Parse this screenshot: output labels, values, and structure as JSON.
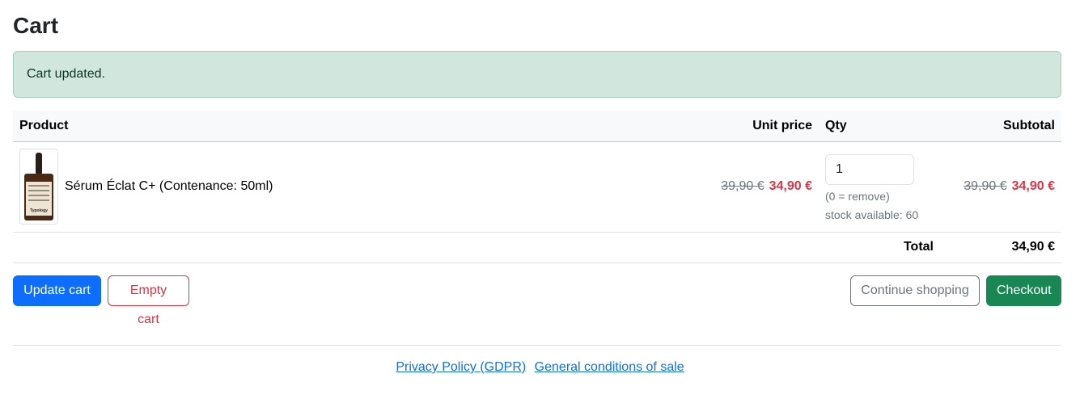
{
  "page": {
    "title": "Cart"
  },
  "alert": {
    "message": "Cart updated."
  },
  "table": {
    "headers": {
      "product": "Product",
      "unit_price": "Unit price",
      "qty": "Qty",
      "subtotal": "Subtotal"
    },
    "items": [
      {
        "name": "Sérum Éclat C+ (Contenance: 50ml)",
        "thumb_brand": "Typology",
        "unit_price_old": "39,90 €",
        "unit_price_new": "34,90 €",
        "qty": "1",
        "qty_help": "(0 = remove)",
        "stock": "stock available: 60",
        "subtotal_old": "39,90 €",
        "subtotal_new": "34,90 €"
      }
    ],
    "total_label": "Total",
    "total_value": "34,90 €"
  },
  "actions": {
    "update_cart": "Update cart",
    "empty_cart": "Empty cart",
    "continue_shopping": "Continue shopping",
    "checkout": "Checkout"
  },
  "footer": {
    "links": [
      "Privacy Policy (GDPR)",
      "General conditions of sale"
    ]
  },
  "colors": {
    "primary": "#0d6efd",
    "danger": "#dc3545",
    "success": "#198754",
    "secondary": "#6c757d",
    "alert_bg": "#d1e7dd"
  }
}
